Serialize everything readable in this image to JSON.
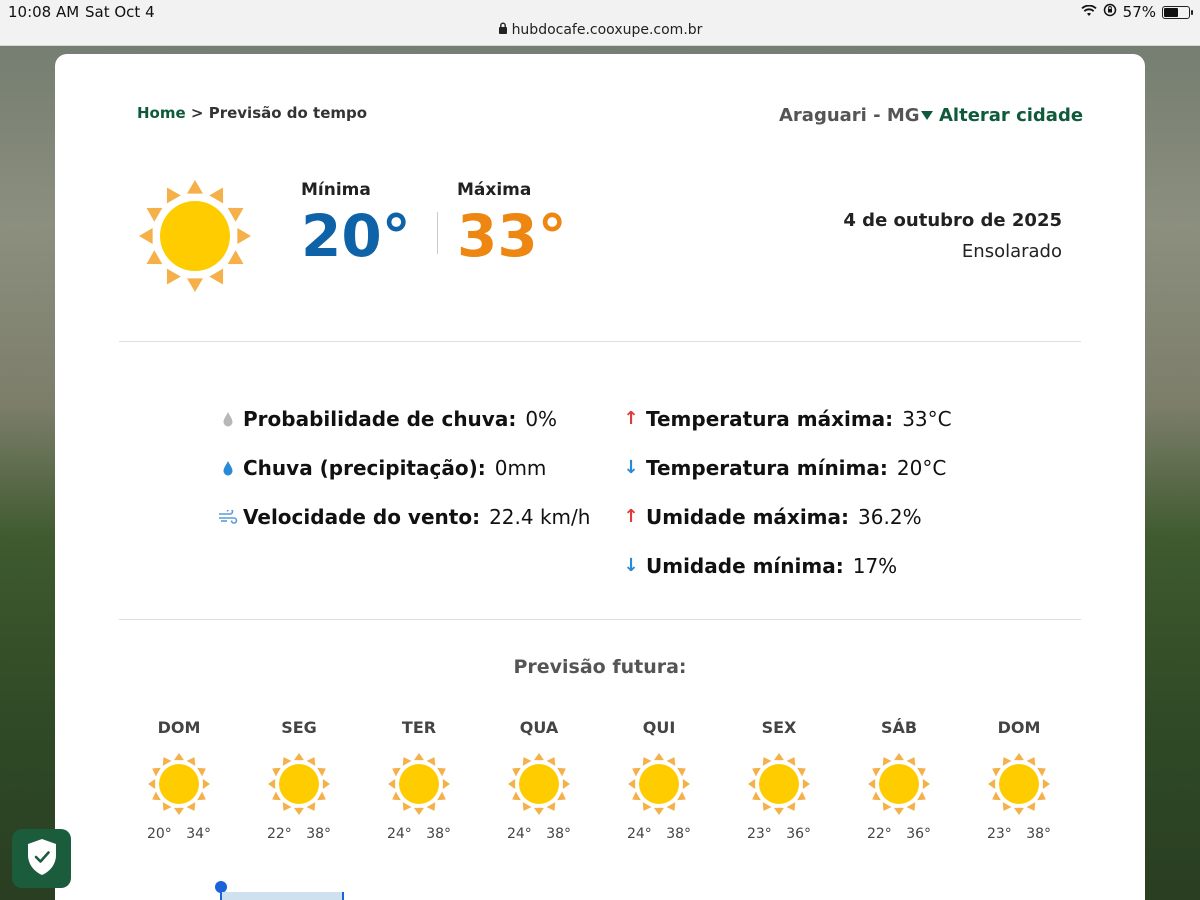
{
  "status": {
    "time": "10:08 AM",
    "date": "Sat Oct 4",
    "battery": "57%",
    "battery_level": 0.57
  },
  "browser": {
    "url": "hubdocafe.cooxupe.com.br"
  },
  "breadcrumb": {
    "home": "Home",
    "separator": ">",
    "current": "Previsão do tempo"
  },
  "location": {
    "city": "Araguari - MG",
    "change_label": "Alterar cidade"
  },
  "today": {
    "min_label": "Mínima",
    "max_label": "Máxima",
    "min": "20°",
    "max": "33°",
    "date": "4 de outubro de 2025",
    "condition": "Ensolarado",
    "icon": "sun-icon"
  },
  "details": {
    "left": [
      {
        "label": "Probabilidade de chuva:",
        "value": "0%",
        "icon": "rain-chance-icon"
      },
      {
        "label": "Chuva (precipitação):",
        "value": "0mm",
        "icon": "raindrop-icon"
      },
      {
        "label": "Velocidade do vento:",
        "value": "22.4 km/h",
        "icon": "wind-icon"
      }
    ],
    "right": [
      {
        "label": "Temperatura máxima:",
        "value": "33°C",
        "icon": "arrow-up-icon"
      },
      {
        "label": "Temperatura mínima:",
        "value": "20°C",
        "icon": "arrow-down-icon"
      },
      {
        "label": "Umidade máxima:",
        "value": "36.2%",
        "icon": "arrow-up-icon"
      },
      {
        "label": "Umidade mínima:",
        "value": "17%",
        "icon": "arrow-down-icon"
      }
    ]
  },
  "forecast": {
    "title": "Previsão futura:",
    "days": [
      {
        "day": "DOM",
        "temps": "20° 34°"
      },
      {
        "day": "SEG",
        "temps": "22° 38°"
      },
      {
        "day": "TER",
        "temps": "24° 38°"
      },
      {
        "day": "QUA",
        "temps": "24° 38°"
      },
      {
        "day": "QUI",
        "temps": "24° 38°"
      },
      {
        "day": "SEX",
        "temps": "23° 36°"
      },
      {
        "day": "SÁB",
        "temps": "22° 36°"
      },
      {
        "day": "DOM",
        "temps": "23° 38°"
      }
    ]
  },
  "colors": {
    "brand": "#0e5a3a",
    "min": "#0d62a8",
    "max": "#ee8612",
    "sun": "#ffcc00",
    "rays": "#f5b04a"
  }
}
